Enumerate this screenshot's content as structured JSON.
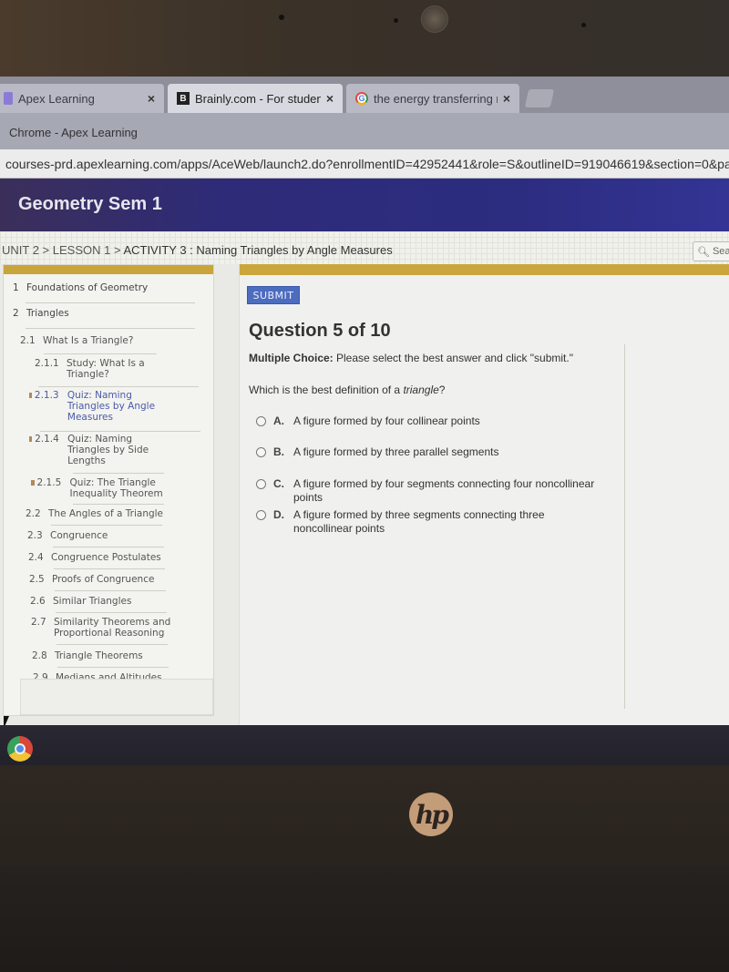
{
  "browser": {
    "tabs": [
      {
        "label": "Apex Learning",
        "icon": "apex-icon",
        "active": false
      },
      {
        "label": "Brainly.com - For student",
        "icon": "brainly-icon",
        "active": true
      },
      {
        "label": "the energy transferring re",
        "icon": "google-icon",
        "active": false
      }
    ],
    "close_glyph": "×",
    "window_title": "Chrome - Apex Learning",
    "url": "courses-prd.apexlearning.com/apps/AceWeb/launch2.do?enrollmentID=42952441&role=S&outlineID=919046619&section=0&pa"
  },
  "course": {
    "title": "Geometry Sem 1"
  },
  "breadcrumb": {
    "path": "UNIT 2 > LESSON 1 > ",
    "current": "ACTIVITY 3 : Naming Triangles by Angle Measures"
  },
  "search": {
    "placeholder": "Sear"
  },
  "sidebar": {
    "items": [
      {
        "num": "1",
        "label": "Foundations of Geometry"
      },
      {
        "num": "2",
        "label": "Triangles"
      },
      {
        "num": "2.1",
        "label": "What Is a Triangle?"
      },
      {
        "num": "2.1.1",
        "label": "Study: What Is a Triangle?"
      },
      {
        "num": "2.1.3",
        "label": "Quiz: Naming Triangles by Angle Measures"
      },
      {
        "num": "2.1.4",
        "label": "Quiz: Naming Triangles by Side Lengths"
      },
      {
        "num": "2.1.5",
        "label": "Quiz: The Triangle Inequality Theorem"
      },
      {
        "num": "2.2",
        "label": "The Angles of a Triangle"
      },
      {
        "num": "2.3",
        "label": "Congruence"
      },
      {
        "num": "2.4",
        "label": "Congruence Postulates"
      },
      {
        "num": "2.5",
        "label": "Proofs of Congruence"
      },
      {
        "num": "2.6",
        "label": "Similar Triangles"
      },
      {
        "num": "2.7",
        "label": "Similarity Theorems and Proportional Reasoning"
      },
      {
        "num": "2.8",
        "label": "Triangle Theorems"
      },
      {
        "num": "2.9",
        "label": "Medians and Altitudes"
      }
    ]
  },
  "quiz": {
    "submit_label": "SUBMIT",
    "question_title": "Question 5 of 10",
    "instruction_bold": "Multiple Choice:",
    "instruction_text": " Please select the best answer and click \"submit.\"",
    "question_prefix": "Which is the best definition of a ",
    "question_term": "triangle",
    "question_suffix": "?",
    "choices": [
      {
        "letter": "A.",
        "text": "A figure formed by four collinear points"
      },
      {
        "letter": "B.",
        "text": "A figure formed by three parallel segments"
      },
      {
        "letter": "C.",
        "text": "A figure formed by four segments connecting four noncollinear points"
      },
      {
        "letter": "D.",
        "text": "A figure formed by three segments connecting three noncollinear points"
      }
    ]
  },
  "device": {
    "brand": "hp"
  },
  "colors": {
    "course_header": "#2e2b78",
    "accent_gold": "#c9a43a",
    "submit_blue": "#4c6cbf",
    "active_link": "#4a5aa8"
  }
}
